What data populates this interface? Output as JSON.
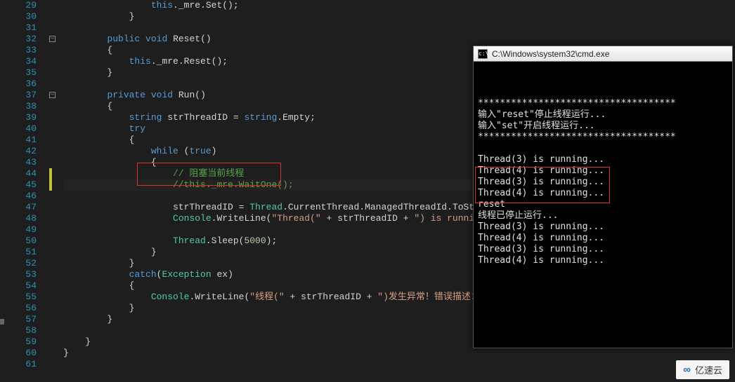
{
  "gutter": {
    "start": 29,
    "end": 61
  },
  "folds": [
    {
      "line": 32,
      "glyph": "-"
    },
    {
      "line": 37,
      "glyph": "-"
    }
  ],
  "margin_marker": {
    "top_line": 44,
    "height_lines": 2
  },
  "code": {
    "l29": {
      "pre": "                ",
      "this": "this",
      "t1": "._mre.Set();"
    },
    "l30": "            }",
    "l31": "",
    "l32": {
      "pre": "        ",
      "kw1": "public",
      "sp1": " ",
      "kw2": "void",
      "t": " Reset()"
    },
    "l33": "        {",
    "l34": {
      "pre": "            ",
      "this": "this",
      "t1": "._mre.Reset();"
    },
    "l35": "        }",
    "l36": "",
    "l37": {
      "pre": "        ",
      "kw1": "private",
      "sp1": " ",
      "kw2": "void",
      "t": " Run()"
    },
    "l38": "        {",
    "l39": {
      "pre": "            ",
      "typ": "string",
      "t1": " strThreadID = ",
      "typ2": "string",
      "t2": ".Empty;"
    },
    "l40": {
      "pre": "            ",
      "kw": "try"
    },
    "l41": "            {",
    "l42": {
      "pre": "                ",
      "kw": "while",
      "t1": " (",
      "kw2": "true",
      "t2": ")"
    },
    "l43": "                {",
    "l44": {
      "pre": "                    ",
      "cmt": "// 阻塞当前线程"
    },
    "l45": {
      "pre": "                    ",
      "cmt": "//this._mre.WaitOne();"
    },
    "l46": "",
    "l47": {
      "pre": "                    strThreadID = ",
      "typ": "Thread",
      "t1": ".CurrentThread.ManagedThreadId.ToString();"
    },
    "l48": {
      "pre": "                    ",
      "typ": "Console",
      "t1": ".WriteLine(",
      "s1": "\"Thread(\"",
      "t2": " + strThreadID + ",
      "s2": "\") is running...\"",
      "t3": ");"
    },
    "l49": "",
    "l50": {
      "pre": "                    ",
      "typ": "Thread",
      "t1": ".Sleep(",
      "num": "5000",
      "t2": ");"
    },
    "l51": "                }",
    "l52": "            }",
    "l53": {
      "pre": "            ",
      "kw": "catch",
      "t1": "(",
      "typ": "Exception",
      "t2": " ex)"
    },
    "l54": "            {",
    "l55": {
      "pre": "                ",
      "typ": "Console",
      "t1": ".WriteLine(",
      "s1": "\"线程(\"",
      "t2": " + strThreadID + ",
      "s2": "\")发生异常！错误描述：\"",
      "t3": " + "
    },
    "l56": "            }",
    "l57": "        }",
    "l58": "",
    "l59": "    }",
    "l60": "}",
    "l61": ""
  },
  "console": {
    "title": "C:\\Windows\\system32\\cmd.exe",
    "lines": [
      "************************************",
      "输入\"reset\"停止线程运行...",
      "输入\"set\"开启线程运行...",
      "************************************",
      "",
      "Thread(3) is running...",
      "Thread(4) is running...",
      "Thread(3) is running...",
      "Thread(4) is running...",
      "reset",
      "线程已停止运行...",
      "Thread(3) is running...",
      "Thread(4) is running...",
      "Thread(3) is running...",
      "Thread(4) is running..."
    ]
  },
  "watermark": {
    "logo": "∞",
    "text": "亿速云"
  },
  "colors": {
    "keyword": "#569cd6",
    "type": "#4ec9b0",
    "string": "#d69d85",
    "comment": "#57a64a",
    "number": "#b5cea8",
    "linenum": "#2b91af",
    "highlight_box": "#e03030"
  }
}
